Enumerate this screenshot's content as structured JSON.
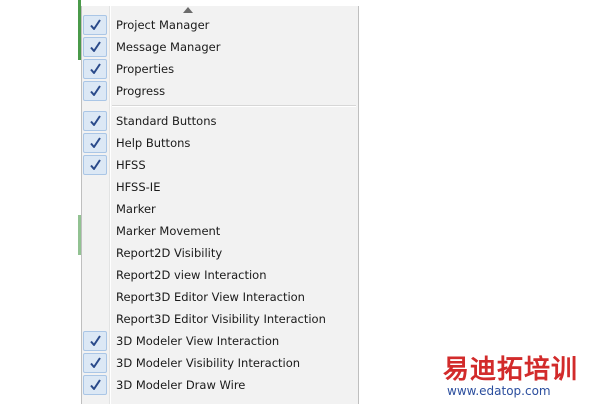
{
  "menu": {
    "groups": [
      {
        "items": [
          {
            "label": "Project Manager",
            "checked": true
          },
          {
            "label": "Message Manager",
            "checked": true
          },
          {
            "label": "Properties",
            "checked": true
          },
          {
            "label": "Progress",
            "checked": true
          }
        ]
      },
      {
        "items": [
          {
            "label": "Standard Buttons",
            "checked": true
          },
          {
            "label": "Help Buttons",
            "checked": true
          },
          {
            "label": "HFSS",
            "checked": true
          },
          {
            "label": "HFSS-IE",
            "checked": false
          },
          {
            "label": "Marker",
            "checked": false
          },
          {
            "label": "Marker Movement",
            "checked": false
          },
          {
            "label": "Report2D Visibility",
            "checked": false
          },
          {
            "label": "Report2D view Interaction",
            "checked": false
          },
          {
            "label": "Report3D Editor View Interaction",
            "checked": false
          },
          {
            "label": "Report3D Editor Visibility Interaction",
            "checked": false
          },
          {
            "label": "3D Modeler View Interaction",
            "checked": true
          },
          {
            "label": "3D Modeler Visibility Interaction",
            "checked": true
          },
          {
            "label": "3D Modeler Draw Wire",
            "checked": true
          }
        ]
      }
    ],
    "scroll_icon": "triangle-up-icon",
    "check_icon": "checkmark-icon"
  },
  "watermark": {
    "text": "易迪拓培训",
    "url": "www.edatop.com"
  },
  "colors": {
    "menu_background": "#f2f2f2",
    "check_highlight": "#dce8f5",
    "check_border": "#aac6e6",
    "checkmark": "#2a4a8a",
    "watermark_red": "#d22b2b",
    "watermark_blue": "#2b4e9e"
  }
}
